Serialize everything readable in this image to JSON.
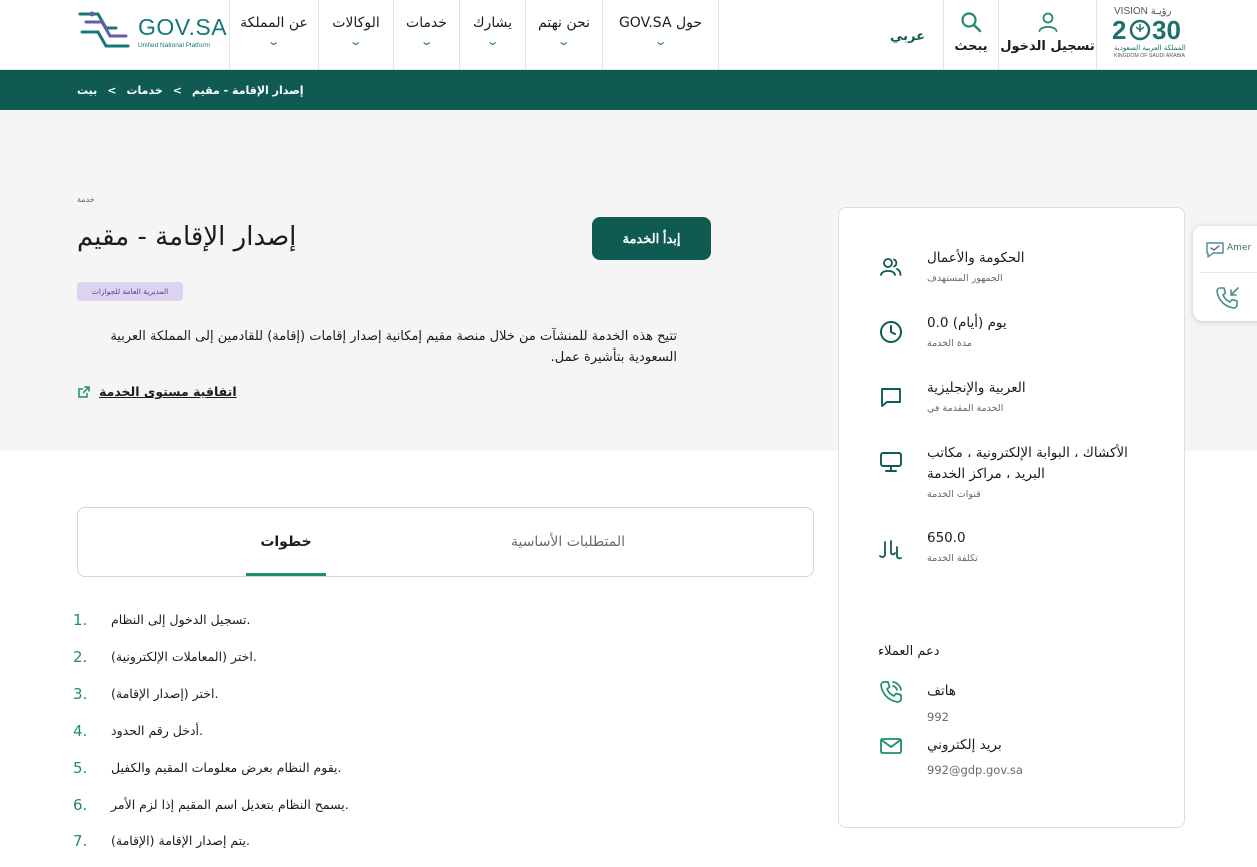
{
  "header": {
    "logo_text": "GOV.SA",
    "logo_sub": "Unified National Platform",
    "nav": [
      {
        "label": "عن المملكة"
      },
      {
        "label": "الوكالات"
      },
      {
        "label": "خدمات"
      },
      {
        "label": "يشارك"
      },
      {
        "label": "نحن نهتم"
      },
      {
        "label": "GOV.SA حول"
      }
    ],
    "language_label": "عربي",
    "search_label": "يبحث",
    "login_label": "تسجيل الدخول",
    "vision": {
      "top": "VISION رؤيـة",
      "year_left": "2",
      "year_right": "30",
      "arabic": "المملكة العربية السعودية",
      "english": "KINGDOM OF SAUDI ARABIA"
    }
  },
  "breadcrumb": {
    "items": [
      "بيت",
      "خدمات",
      "إصدار الإقامة - مقيم"
    ],
    "separator": "<"
  },
  "service": {
    "tag": "خدمة",
    "title": "إصدار الإقامة - مقيم",
    "start_button": "إبدأ الخدمة",
    "org_badge": "المديرية العامة للجوازات",
    "description": "تتيح هذه الخدمة للمنشآت من خلال منصة مقيم إمكانية إصدار إقامات (إقامة) للقادمين إلى المملكة العربية السعودية بتأشيرة عمل.",
    "sla_link": "اتفاقية مستوى الخدمة"
  },
  "tabs": {
    "active": "خطوات",
    "other": "المتطلبات الأساسية"
  },
  "steps": [
    {
      "num": "1.",
      "text": "تسجيل الدخول إلى النظام."
    },
    {
      "num": "2.",
      "text": "اختر (المعاملات الإلكترونية)."
    },
    {
      "num": "3.",
      "text": "اختر (إصدار الإقامة)."
    },
    {
      "num": "4.",
      "text": "أدخل رقم الحدود."
    },
    {
      "num": "5.",
      "text": "يقوم النظام بعرض معلومات المقيم والكفيل."
    },
    {
      "num": "6.",
      "text": "يسمح النظام بتعديل اسم المقيم إذا لزم الأمر."
    },
    {
      "num": "7.",
      "text": "يتم إصدار الإقامة (الإقامة)."
    }
  ],
  "sidebar": {
    "audience": {
      "value": "الحكومة والأعمال",
      "label": "الجمهور المستهدف"
    },
    "duration": {
      "value": "0.0 يوم (أيام)",
      "label": "مدة الخدمة"
    },
    "language": {
      "value": "العربية والإنجليزية",
      "label": "الخدمة المقدمة في"
    },
    "channels": {
      "value_line1": "الأكشاك ، البوابة الإلكترونية ، مكاتب",
      "value_line2": "البريد ، مراكز الخدمة",
      "label": "قنوات الخدمة"
    },
    "cost": {
      "value": "650.0",
      "label": "تكلفة الخدمة"
    },
    "support": {
      "title": "دعم العملاء",
      "phone_label": "هاتف",
      "phone_value": "992",
      "email_label": "بريد إلكتروني",
      "email_value": "992@gdp.gov.sa"
    }
  },
  "floating": {
    "chat_label": "Amer"
  },
  "colors": {
    "primary": "#0f5b51",
    "accent": "#1f8c6e",
    "badge_bg": "#ddd3ef",
    "hero_bg": "#f5f5f5"
  }
}
